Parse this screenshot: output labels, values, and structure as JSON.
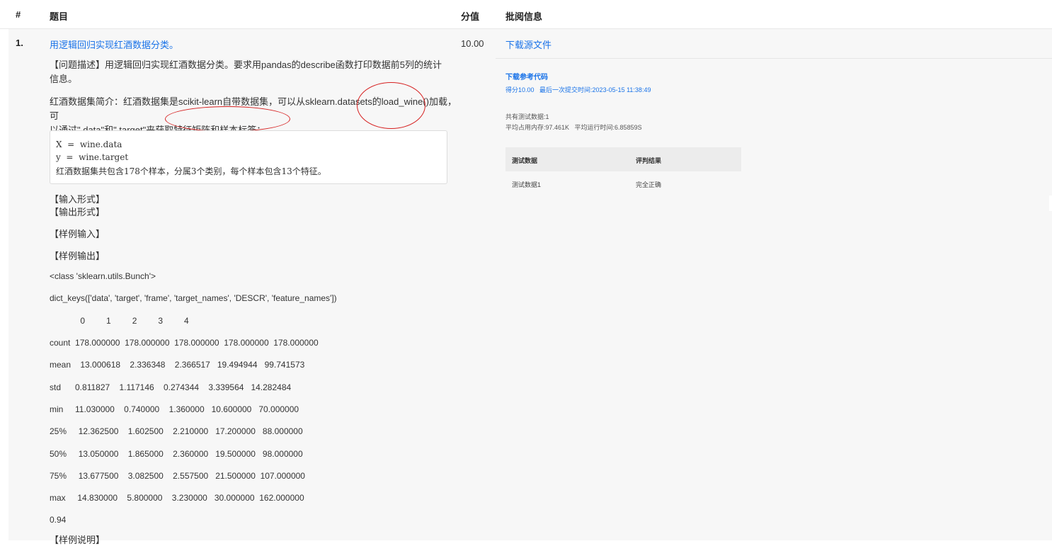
{
  "header": {
    "col_num": "#",
    "col_title": "题目",
    "col_score": "分值",
    "col_review": "批阅信息"
  },
  "question": {
    "number": "1.",
    "title": "用逻辑回归实现红酒数据分类。",
    "score": "10.00",
    "desc1_line1": "【问题描述】用逻辑回归实现红酒数据分类。要求用pandas的describe函数打印数据前5列的统计",
    "desc1_line2": "信息。",
    "desc2_line1": "红酒数据集简介：红酒数据集是scikit-learn自带数据集，可以从sklearn.datasets的load_wine()加载，可",
    "desc2_line2": "以通过\".data\"和\".target\"来获取特征矩阵和样本标签：",
    "code": [
      "X  =  wine.data",
      "y  =  wine.target",
      "红酒数据集共包含178个样本，分属3个类别，每个样本包含13个特征。"
    ],
    "input_format": "【输入形式】",
    "output_format": "【输出形式】",
    "sample_input": "【样例输入】",
    "sample_output": "【样例输出】",
    "output_lines": [
      "<class 'sklearn.utils.Bunch'>",
      "dict_keys(['data', 'target', 'frame', 'target_names', 'DESCR', 'feature_names'])",
      "             0         1         2         3         4",
      "count  178.000000  178.000000  178.000000  178.000000  178.000000",
      "mean    13.000618    2.336348    2.366517   19.494944   99.741573",
      "std      0.811827    1.117146    0.274344    3.339564   14.282484",
      "min     11.030000    0.740000    1.360000   10.600000   70.000000",
      "25%     12.362500    1.602500    2.210000   17.200000   88.000000",
      "50%     13.050000    1.865000    2.360000   19.500000   98.000000",
      "75%     13.677500    3.082500    2.557500   21.500000  107.000000",
      "max     14.830000    5.800000    3.230000   30.000000  162.000000",
      "0.94"
    ],
    "sample_note": "【样例说明】"
  },
  "review": {
    "download_source": "下载源文件",
    "download_ref": "下载参考代码",
    "score_label": "得分10.00",
    "last_submit": "最后一次提交时间:2023-05-15 11:38:49",
    "test_count": "共有测试数据:1",
    "memory": "平均占用内存:97.461K",
    "runtime": "平均运行时间:6.85859S",
    "table": {
      "headers": [
        "测试数据",
        "评判结果"
      ],
      "rows": [
        [
          "测试数据1",
          "完全正确"
        ]
      ]
    }
  },
  "colors": {
    "link": "#1a73e8",
    "annotation": "#d62020"
  }
}
